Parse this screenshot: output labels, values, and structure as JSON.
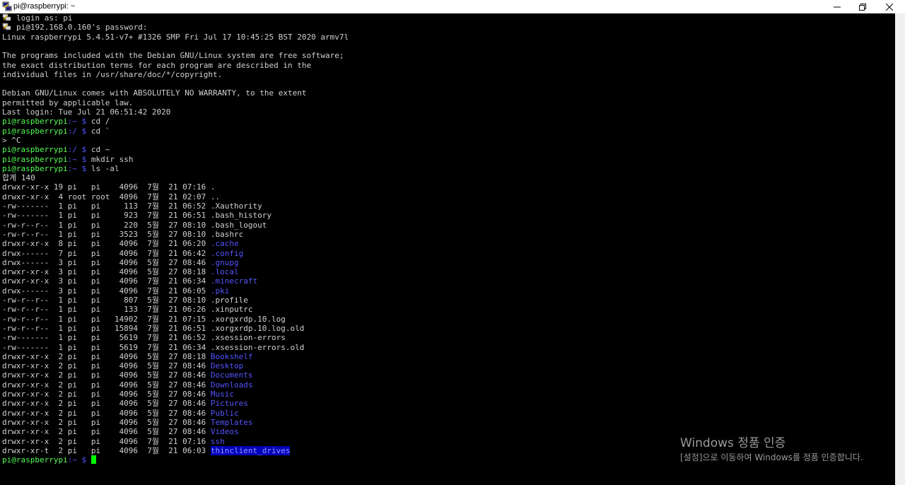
{
  "window": {
    "title": "pi@raspberrypi: ~"
  },
  "colors": {
    "prompt": "#54ff54",
    "directory": "#5454ff",
    "text": "#bbbbbb",
    "cursor": "#00ff00",
    "highlight_bg": "#0000bb"
  },
  "prompt": {
    "user_host": "pi@raspberrypi",
    "dollar": "$"
  },
  "terminal": {
    "login_as": "login as: pi",
    "password": "pi@192.168.0.160's password:",
    "motd": [
      "Linux raspberrypi 5.4.51-v7+ #1326 SMP Fri Jul 17 10:45:25 BST 2020 armv7l",
      "",
      "The programs included with the Debian GNU/Linux system are free software;",
      "the exact distribution terms for each program are described in the",
      "individual files in /usr/share/doc/*/copyright.",
      "",
      "Debian GNU/Linux comes with ABSOLUTELY NO WARRANTY, to the extent",
      "permitted by applicable law.",
      "Last login: Tue Jul 21 06:51:42 2020"
    ],
    "commands": [
      {
        "path": ":~",
        "cmd": "cd /"
      },
      {
        "path": ":/",
        "cmd": "cd `"
      },
      {
        "continuation": "> ^C"
      },
      {
        "path": ":/",
        "cmd": "cd ~"
      },
      {
        "path": ":~",
        "cmd": "mkdir ssh"
      },
      {
        "path": ":~",
        "cmd": "ls -al"
      }
    ],
    "total": "합계 140",
    "listing": [
      {
        "meta": "drwxr-xr-x 19 pi   pi    4096  7월  21 07:16 ",
        "name": ".",
        "type": "plain"
      },
      {
        "meta": "drwxr-xr-x  4 root root  4096  7월  21 02:07 ",
        "name": "..",
        "type": "plain"
      },
      {
        "meta": "-rw-------  1 pi   pi     113  7월  21 06:52 ",
        "name": ".Xauthority",
        "type": "plain"
      },
      {
        "meta": "-rw-------  1 pi   pi     923  7월  21 06:51 ",
        "name": ".bash_history",
        "type": "plain"
      },
      {
        "meta": "-rw-r--r--  1 pi   pi     220  5월  27 08:10 ",
        "name": ".bash_logout",
        "type": "plain"
      },
      {
        "meta": "-rw-r--r--  1 pi   pi    3523  5월  27 08:10 ",
        "name": ".bashrc",
        "type": "plain"
      },
      {
        "meta": "drwxr-xr-x  8 pi   pi    4096  7월  21 06:20 ",
        "name": ".cache",
        "type": "dir"
      },
      {
        "meta": "drwx------  7 pi   pi    4096  7월  21 06:42 ",
        "name": ".config",
        "type": "dir"
      },
      {
        "meta": "drwx------  3 pi   pi    4096  5월  27 08:46 ",
        "name": ".gnupg",
        "type": "dir"
      },
      {
        "meta": "drwxr-xr-x  3 pi   pi    4096  5월  27 08:18 ",
        "name": ".local",
        "type": "dir"
      },
      {
        "meta": "drwxr-xr-x  3 pi   pi    4096  7월  21 06:34 ",
        "name": ".minecraft",
        "type": "dir"
      },
      {
        "meta": "drwx------  3 pi   pi    4096  7월  21 06:05 ",
        "name": ".pki",
        "type": "dir"
      },
      {
        "meta": "-rw-r--r--  1 pi   pi     807  5월  27 08:10 ",
        "name": ".profile",
        "type": "plain"
      },
      {
        "meta": "-rw-r--r--  1 pi   pi     133  7월  21 06:26 ",
        "name": ".xinputrc",
        "type": "plain"
      },
      {
        "meta": "-rw-r--r--  1 pi   pi   14902  7월  21 07:15 ",
        "name": ".xorgxrdp.10.log",
        "type": "plain"
      },
      {
        "meta": "-rw-r--r--  1 pi   pi   15894  7월  21 06:51 ",
        "name": ".xorgxrdp.10.log.old",
        "type": "plain"
      },
      {
        "meta": "-rw-------  1 pi   pi    5619  7월  21 06:52 ",
        "name": ".xsession-errors",
        "type": "plain"
      },
      {
        "meta": "-rw-------  1 pi   pi    5619  7월  21 06:34 ",
        "name": ".xsession-errors.old",
        "type": "plain"
      },
      {
        "meta": "drwxr-xr-x  2 pi   pi    4096  5월  27 08:18 ",
        "name": "Bookshelf",
        "type": "dir"
      },
      {
        "meta": "drwxr-xr-x  2 pi   pi    4096  5월  27 08:46 ",
        "name": "Desktop",
        "type": "dir"
      },
      {
        "meta": "drwxr-xr-x  2 pi   pi    4096  5월  27 08:46 ",
        "name": "Documents",
        "type": "dir"
      },
      {
        "meta": "drwxr-xr-x  2 pi   pi    4096  5월  27 08:46 ",
        "name": "Downloads",
        "type": "dir"
      },
      {
        "meta": "drwxr-xr-x  2 pi   pi    4096  5월  27 08:46 ",
        "name": "Music",
        "type": "dir"
      },
      {
        "meta": "drwxr-xr-x  2 pi   pi    4096  5월  27 08:46 ",
        "name": "Pictures",
        "type": "dir"
      },
      {
        "meta": "drwxr-xr-x  2 pi   pi    4096  5월  27 08:46 ",
        "name": "Public",
        "type": "dir"
      },
      {
        "meta": "drwxr-xr-x  2 pi   pi    4096  5월  27 08:46 ",
        "name": "Templates",
        "type": "dir"
      },
      {
        "meta": "drwxr-xr-x  2 pi   pi    4096  5월  27 08:46 ",
        "name": "Videos",
        "type": "dir"
      },
      {
        "meta": "drwxr-xr-x  2 pi   pi    4096  7월  21 07:16 ",
        "name": "ssh",
        "type": "dir"
      },
      {
        "meta": "drwxr-xr-t  2 pi   pi    4096  7월  21 06:03 ",
        "name": "thinclient_drives",
        "type": "highlight"
      }
    ],
    "final_prompt": {
      "path": ":~"
    }
  },
  "activation": {
    "title": "Windows 정품 인증",
    "subtitle": "[설정]으로 이동하여 Windows를 정품 인증합니다."
  }
}
